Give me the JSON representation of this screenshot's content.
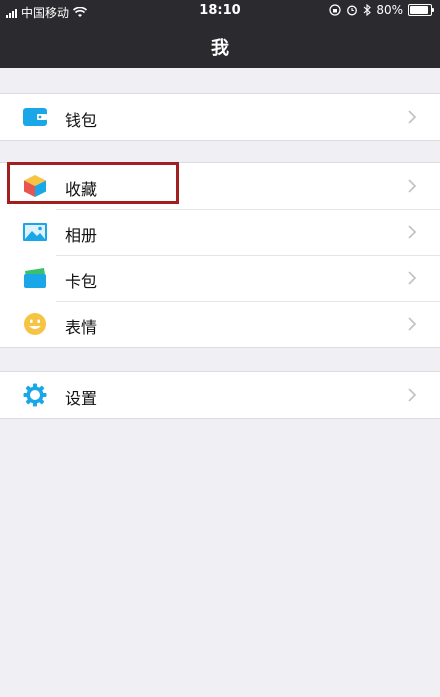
{
  "status_bar": {
    "carrier": "中国移动",
    "time": "18:10",
    "battery_percent": "80%",
    "battery_level": 0.8
  },
  "nav": {
    "title": "我"
  },
  "groups": [
    {
      "items": [
        {
          "label": "钱包",
          "icon": "wallet-icon"
        }
      ]
    },
    {
      "items": [
        {
          "label": "收藏",
          "icon": "favorites-cube-icon",
          "highlighted": true
        },
        {
          "label": "相册",
          "icon": "album-picture-icon"
        },
        {
          "label": "卡包",
          "icon": "card-bag-icon"
        },
        {
          "label": "表情",
          "icon": "emoji-smile-icon"
        }
      ]
    },
    {
      "items": [
        {
          "label": "设置",
          "icon": "settings-gear-icon"
        }
      ]
    }
  ],
  "colors": {
    "nav_bg": "#2b2b2f",
    "page_bg": "#efeff4",
    "highlight_border": "#a11f1f",
    "icon_blue": "#1aa7e8",
    "icon_yellow": "#f6c343"
  }
}
